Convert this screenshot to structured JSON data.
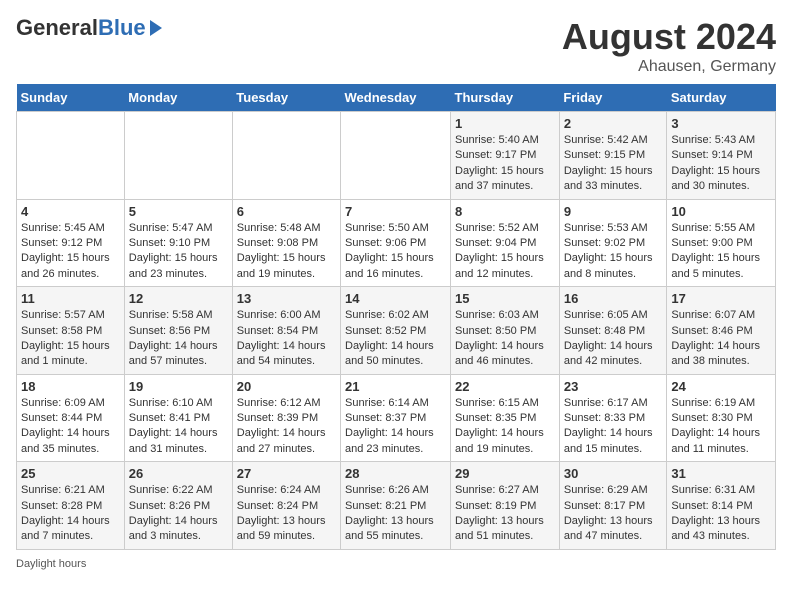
{
  "logo": {
    "general": "General",
    "blue": "Blue"
  },
  "title": {
    "month_year": "August 2024",
    "location": "Ahausen, Germany"
  },
  "days_of_week": [
    "Sunday",
    "Monday",
    "Tuesday",
    "Wednesday",
    "Thursday",
    "Friday",
    "Saturday"
  ],
  "weeks": [
    [
      {
        "day": "",
        "info": ""
      },
      {
        "day": "",
        "info": ""
      },
      {
        "day": "",
        "info": ""
      },
      {
        "day": "",
        "info": ""
      },
      {
        "day": "1",
        "info": "Sunrise: 5:40 AM\nSunset: 9:17 PM\nDaylight: 15 hours\nand 37 minutes."
      },
      {
        "day": "2",
        "info": "Sunrise: 5:42 AM\nSunset: 9:15 PM\nDaylight: 15 hours\nand 33 minutes."
      },
      {
        "day": "3",
        "info": "Sunrise: 5:43 AM\nSunset: 9:14 PM\nDaylight: 15 hours\nand 30 minutes."
      }
    ],
    [
      {
        "day": "4",
        "info": "Sunrise: 5:45 AM\nSunset: 9:12 PM\nDaylight: 15 hours\nand 26 minutes."
      },
      {
        "day": "5",
        "info": "Sunrise: 5:47 AM\nSunset: 9:10 PM\nDaylight: 15 hours\nand 23 minutes."
      },
      {
        "day": "6",
        "info": "Sunrise: 5:48 AM\nSunset: 9:08 PM\nDaylight: 15 hours\nand 19 minutes."
      },
      {
        "day": "7",
        "info": "Sunrise: 5:50 AM\nSunset: 9:06 PM\nDaylight: 15 hours\nand 16 minutes."
      },
      {
        "day": "8",
        "info": "Sunrise: 5:52 AM\nSunset: 9:04 PM\nDaylight: 15 hours\nand 12 minutes."
      },
      {
        "day": "9",
        "info": "Sunrise: 5:53 AM\nSunset: 9:02 PM\nDaylight: 15 hours\nand 8 minutes."
      },
      {
        "day": "10",
        "info": "Sunrise: 5:55 AM\nSunset: 9:00 PM\nDaylight: 15 hours\nand 5 minutes."
      }
    ],
    [
      {
        "day": "11",
        "info": "Sunrise: 5:57 AM\nSunset: 8:58 PM\nDaylight: 15 hours\nand 1 minute."
      },
      {
        "day": "12",
        "info": "Sunrise: 5:58 AM\nSunset: 8:56 PM\nDaylight: 14 hours\nand 57 minutes."
      },
      {
        "day": "13",
        "info": "Sunrise: 6:00 AM\nSunset: 8:54 PM\nDaylight: 14 hours\nand 54 minutes."
      },
      {
        "day": "14",
        "info": "Sunrise: 6:02 AM\nSunset: 8:52 PM\nDaylight: 14 hours\nand 50 minutes."
      },
      {
        "day": "15",
        "info": "Sunrise: 6:03 AM\nSunset: 8:50 PM\nDaylight: 14 hours\nand 46 minutes."
      },
      {
        "day": "16",
        "info": "Sunrise: 6:05 AM\nSunset: 8:48 PM\nDaylight: 14 hours\nand 42 minutes."
      },
      {
        "day": "17",
        "info": "Sunrise: 6:07 AM\nSunset: 8:46 PM\nDaylight: 14 hours\nand 38 minutes."
      }
    ],
    [
      {
        "day": "18",
        "info": "Sunrise: 6:09 AM\nSunset: 8:44 PM\nDaylight: 14 hours\nand 35 minutes."
      },
      {
        "day": "19",
        "info": "Sunrise: 6:10 AM\nSunset: 8:41 PM\nDaylight: 14 hours\nand 31 minutes."
      },
      {
        "day": "20",
        "info": "Sunrise: 6:12 AM\nSunset: 8:39 PM\nDaylight: 14 hours\nand 27 minutes."
      },
      {
        "day": "21",
        "info": "Sunrise: 6:14 AM\nSunset: 8:37 PM\nDaylight: 14 hours\nand 23 minutes."
      },
      {
        "day": "22",
        "info": "Sunrise: 6:15 AM\nSunset: 8:35 PM\nDaylight: 14 hours\nand 19 minutes."
      },
      {
        "day": "23",
        "info": "Sunrise: 6:17 AM\nSunset: 8:33 PM\nDaylight: 14 hours\nand 15 minutes."
      },
      {
        "day": "24",
        "info": "Sunrise: 6:19 AM\nSunset: 8:30 PM\nDaylight: 14 hours\nand 11 minutes."
      }
    ],
    [
      {
        "day": "25",
        "info": "Sunrise: 6:21 AM\nSunset: 8:28 PM\nDaylight: 14 hours\nand 7 minutes."
      },
      {
        "day": "26",
        "info": "Sunrise: 6:22 AM\nSunset: 8:26 PM\nDaylight: 14 hours\nand 3 minutes."
      },
      {
        "day": "27",
        "info": "Sunrise: 6:24 AM\nSunset: 8:24 PM\nDaylight: 13 hours\nand 59 minutes."
      },
      {
        "day": "28",
        "info": "Sunrise: 6:26 AM\nSunset: 8:21 PM\nDaylight: 13 hours\nand 55 minutes."
      },
      {
        "day": "29",
        "info": "Sunrise: 6:27 AM\nSunset: 8:19 PM\nDaylight: 13 hours\nand 51 minutes."
      },
      {
        "day": "30",
        "info": "Sunrise: 6:29 AM\nSunset: 8:17 PM\nDaylight: 13 hours\nand 47 minutes."
      },
      {
        "day": "31",
        "info": "Sunrise: 6:31 AM\nSunset: 8:14 PM\nDaylight: 13 hours\nand 43 minutes."
      }
    ]
  ],
  "footer": {
    "daylight_label": "Daylight hours"
  }
}
